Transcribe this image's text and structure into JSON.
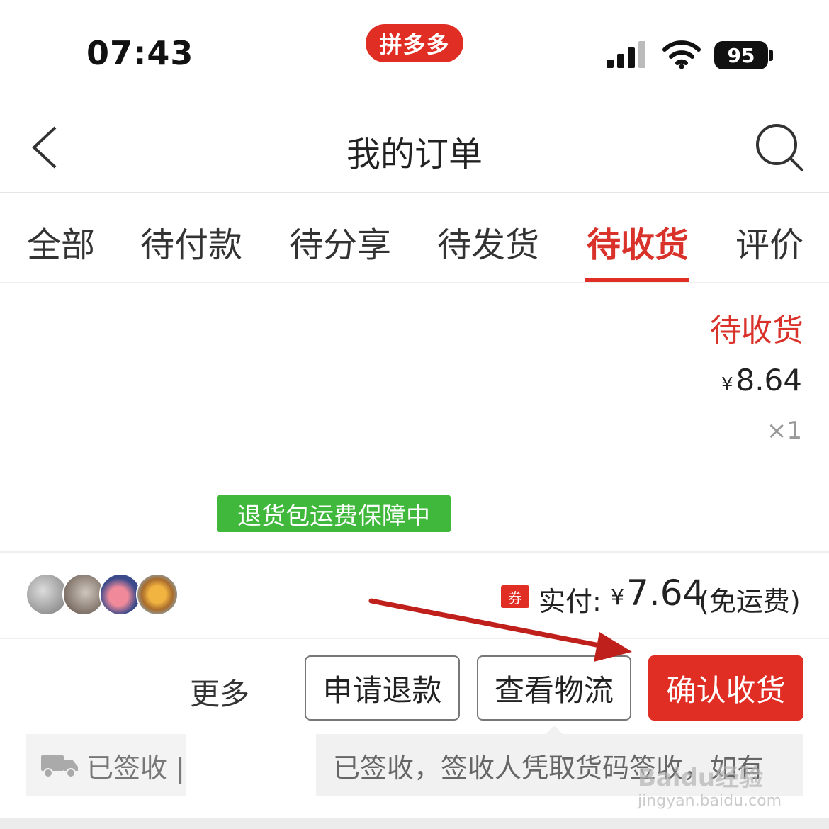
{
  "status_bar": {
    "time": "07:43",
    "app_badge": "拼多多",
    "battery": "95"
  },
  "nav": {
    "title": "我的订单",
    "back_icon": "chevron-left-icon",
    "search_icon": "search-icon"
  },
  "tabs": [
    {
      "label": "全部",
      "active": false
    },
    {
      "label": "待付款",
      "active": false
    },
    {
      "label": "待分享",
      "active": false
    },
    {
      "label": "待发货",
      "active": false
    },
    {
      "label": "待收货",
      "active": true
    },
    {
      "label": "评价",
      "active": false
    }
  ],
  "order": {
    "status": "待收货",
    "price_symbol": "¥",
    "price": "8.64",
    "quantity": "×1",
    "guarantee_tag": "退货包运费保障中",
    "coupon_label": "券",
    "paid_label": "实付:",
    "paid_symbol": "¥",
    "paid_amount": "7.64",
    "paid_note": "(免运费)"
  },
  "actions": {
    "more": "更多",
    "refund": "申请退款",
    "logistics": "查看物流",
    "confirm": "确认收货"
  },
  "logistics": {
    "left_text": "已签收 |",
    "tooltip": "已签收，签收人凭取货码签收，如有"
  },
  "watermark": {
    "logo": "Baidu经验",
    "url": "jingyan.baidu.com"
  },
  "colors": {
    "accent": "#e02e24",
    "active_tab_text": "#d9322b",
    "guarantee_green": "#3fb83b",
    "arrow": "#c0201c"
  }
}
